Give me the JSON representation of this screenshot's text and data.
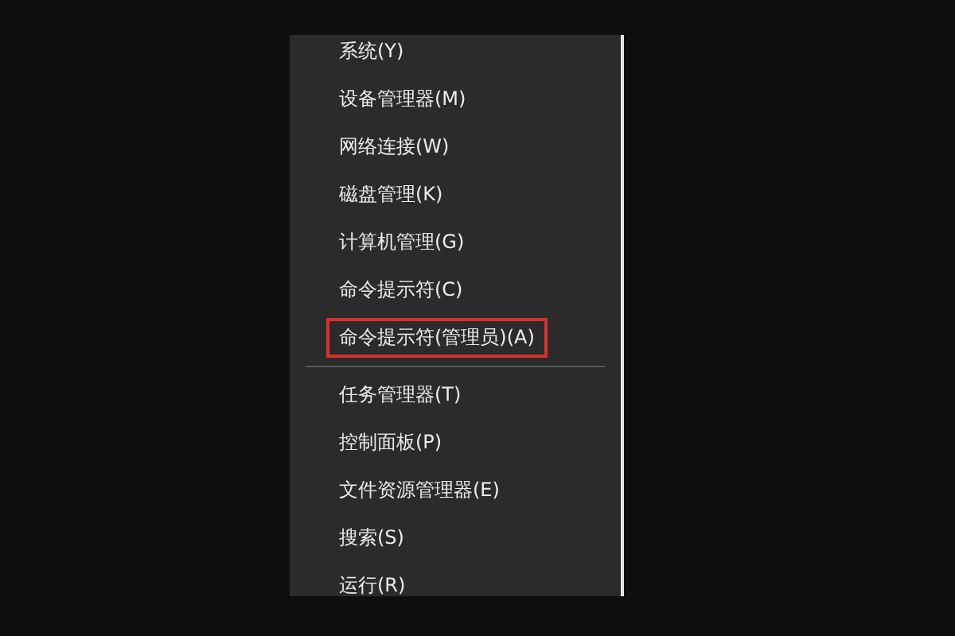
{
  "menu": {
    "groups": [
      {
        "items": [
          {
            "label": "系统(Y)",
            "highlighted": false
          },
          {
            "label": "设备管理器(M)",
            "highlighted": false
          },
          {
            "label": "网络连接(W)",
            "highlighted": false
          },
          {
            "label": "磁盘管理(K)",
            "highlighted": false
          },
          {
            "label": "计算机管理(G)",
            "highlighted": false
          },
          {
            "label": "命令提示符(C)",
            "highlighted": false
          },
          {
            "label": "命令提示符(管理员)(A)",
            "highlighted": true
          }
        ]
      },
      {
        "items": [
          {
            "label": "任务管理器(T)",
            "highlighted": false
          },
          {
            "label": "控制面板(P)",
            "highlighted": false
          },
          {
            "label": "文件资源管理器(E)",
            "highlighted": false
          },
          {
            "label": "搜索(S)",
            "highlighted": false
          },
          {
            "label": "运行(R)",
            "highlighted": false
          }
        ]
      }
    ]
  }
}
